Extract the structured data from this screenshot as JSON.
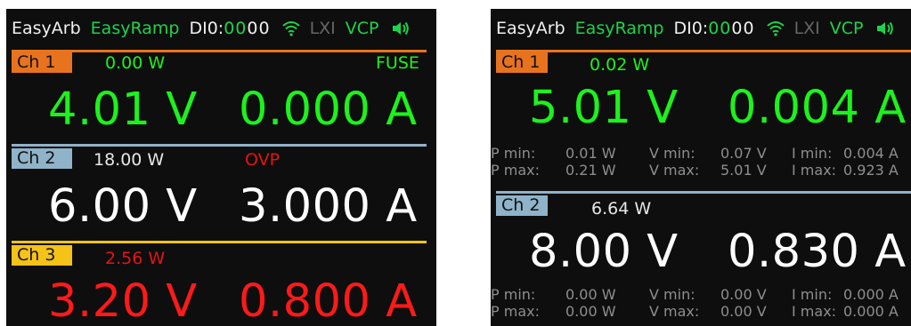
{
  "left": {
    "status": {
      "easyarb": "EasyArb",
      "easyramp": "EasyRamp",
      "dio_label": "DI0:",
      "dio_bits": [
        "0",
        "0",
        "0",
        "0"
      ],
      "lxi": "LXI",
      "vcp": "VCP"
    },
    "ch1": {
      "tag": "Ch 1",
      "power": "0.00 W",
      "flag": "FUSE",
      "voltage": "4.01 V",
      "current": "0.000 A",
      "bar_color": "#e8731e"
    },
    "ch2": {
      "tag": "Ch 2",
      "power": "18.00 W",
      "flag": "OVP",
      "voltage": "6.00 V",
      "current": "3.000 A",
      "bar_color": "#8fb3c9"
    },
    "ch3": {
      "tag": "Ch 3",
      "power": "2.56 W",
      "voltage": "3.20 V",
      "current": "0.800 A",
      "bar_color": "#f5c218"
    }
  },
  "right": {
    "status": {
      "easyarb": "EasyArb",
      "easyramp": "EasyRamp",
      "dio_label": "DI0:",
      "dio_bits": [
        "0",
        "0",
        "0",
        "0"
      ],
      "lxi": "LXI",
      "vcp": "VCP"
    },
    "ch1": {
      "tag": "Ch 1",
      "power": "0.02 W",
      "voltage": "5.01 V",
      "current": "0.004 A",
      "stats": {
        "pmin_label": "P min:",
        "pmin": "0.01 W",
        "vmin_label": "V min:",
        "vmin": "0.07 V",
        "imin_label": "I min:",
        "imin": "0.004 A",
        "pmax_label": "P max:",
        "pmax": "0.21 W",
        "vmax_label": "V max:",
        "vmax": "5.01 V",
        "imax_label": "I max:",
        "imax": "0.923 A"
      }
    },
    "ch2": {
      "tag": "Ch 2",
      "power": "6.64 W",
      "voltage": "8.00 V",
      "current": "0.830 A",
      "stats": {
        "pmin_label": "P min:",
        "pmin": "0.00 W",
        "vmin_label": "V min:",
        "vmin": "0.00 V",
        "imin_label": "I min:",
        "imin": "0.000 A",
        "pmax_label": "P max:",
        "pmax": "0.00 W",
        "vmax_label": "V max:",
        "vmax": "0.00 V",
        "imax_label": "I max:",
        "imax": "0.000 A"
      }
    }
  },
  "colors": {
    "accent_green": "#1cf21c",
    "ch1": "#e8731e",
    "ch2": "#8fb3c9",
    "ch3": "#f5c218",
    "alarm_red": "#ff1a1a"
  }
}
